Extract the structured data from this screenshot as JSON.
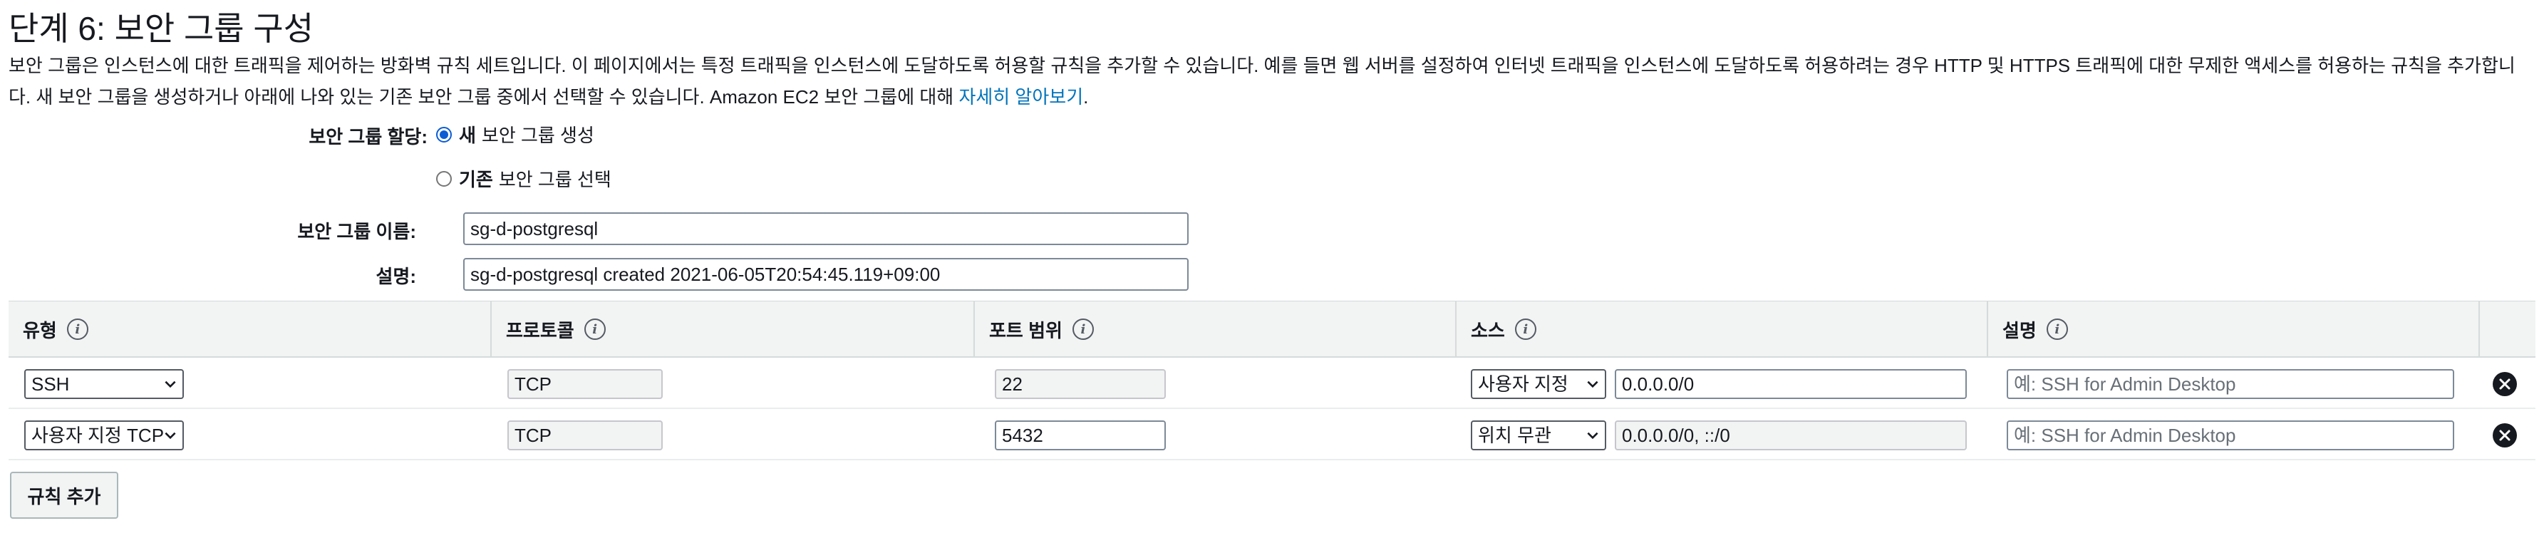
{
  "step_title": "단계 6: 보안 그룹 구성",
  "description": {
    "text": "보안 그룹은 인스턴스에 대한 트래픽을 제어하는 방화벽 규칙 세트입니다. 이 페이지에서는 특정 트래픽을 인스턴스에 도달하도록 허용할 규칙을 추가할 수 있습니다. 예를 들면 웹 서버를 설정하여 인터넷 트래픽을 인스턴스에 도달하도록 허용하려는 경우 HTTP 및 HTTPS 트래픽에 대한 무제한 액세스를 허용하는 규칙을 추가합니다. 새 보안 그룹을 생성하거나 아래에 나와 있는 기존 보안 그룹 중에서 선택할 수 있습니다. Amazon EC2 보안 그룹에 대해 ",
    "link": "자세히 알아보기",
    "suffix": "."
  },
  "assignment": {
    "label": "보안 그룹 할당:",
    "options": [
      {
        "bold": "새",
        "rest": "보안 그룹 생성",
        "checked": true
      },
      {
        "bold": "기존",
        "rest": "보안 그룹 선택",
        "checked": false
      }
    ]
  },
  "name_field": {
    "label": "보안 그룹 이름:",
    "value": "sg-d-postgresql"
  },
  "desc_field": {
    "label": "설명:",
    "value": "sg-d-postgresql created 2021-06-05T20:54:45.119+09:00"
  },
  "table": {
    "headers": [
      "유형",
      "프로토콜",
      "포트 범위",
      "소스",
      "설명"
    ],
    "info_icon": "i",
    "rows": [
      {
        "type": "SSH",
        "protocol": "TCP",
        "port": "22",
        "port_editable": false,
        "source_type": "사용자 지정",
        "source": "0.0.0.0/0",
        "source_editable": true,
        "desc_placeholder": "예: SSH for Admin Desktop"
      },
      {
        "type": "사용자 지정 TCP",
        "protocol": "TCP",
        "port": "5432",
        "port_editable": true,
        "source_type": "위치 무관",
        "source": "0.0.0.0/0, ::/0",
        "source_editable": false,
        "desc_placeholder": "예: SSH for Admin Desktop"
      }
    ]
  },
  "add_rule_label": "규칙 추가",
  "colors": {
    "link": "#0073bb",
    "radio_accent": "#0b5cd5",
    "header_bg": "#f2f3f3"
  }
}
